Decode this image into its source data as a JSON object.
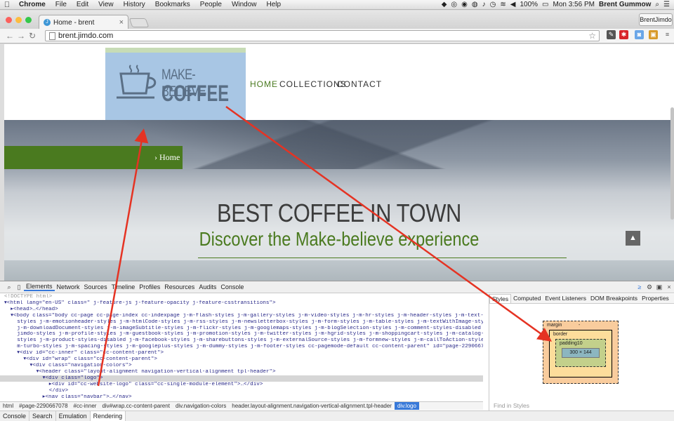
{
  "menubar": {
    "app": "Chrome",
    "items": [
      "File",
      "Edit",
      "View",
      "History",
      "Bookmarks",
      "People",
      "Window",
      "Help"
    ],
    "battery": "100%",
    "clock": "Mon 3:56 PM",
    "user": "Brent Gummow"
  },
  "browser": {
    "tab_title": "Home - brent",
    "url": "brent.jimdo.com",
    "profile": "BrentJimdo"
  },
  "page": {
    "logo_line1": "MAKE-BELIEVE",
    "logo_line2": "COFFEE",
    "nav": [
      "HOME",
      "COLLECTIONS",
      "CONTACT"
    ],
    "breadcrumb": "› Home",
    "headline": "BEST COFFEE IN TOWN",
    "subheadline": "Discover the Make-believe experience"
  },
  "devtools": {
    "tabs": [
      "Elements",
      "Network",
      "Sources",
      "Timeline",
      "Profiles",
      "Resources",
      "Audits",
      "Console"
    ],
    "dom_lines": [
      "<!DOCTYPE html>",
      "▾<html lang=\"en-US\" class=\" j-feature-js j-feature-opacity j-feature-csstransitions\">",
      "  ▸<head>…</head>",
      "  ▾<body class=\"body cc-page cc-page-index cc-indexpage j-m-flash-styles j-m-gallery-styles j-m-video-styles j-m-hr-styles j-m-header-styles j-m-text-",
      "    styles j-m-emotionheader-styles j-m-htmlCode-styles j-m-rss-styles j-m-newsletterbox-styles j-m-form-styles j-m-table-styles j-m-textWithImage-styles",
      "    j-m-downloadDocument-styles j-m-imageSubtitle-styles j-m-flickr-styles j-m-googlemaps-styles j-m-blogSelection-styles j-m-comment-styles-disabled j-m-",
      "    jimdo-styles j-m-profile-styles j-m-guestbook-styles j-m-promotion-styles j-m-twitter-styles j-m-hgrid-styles j-m-shoppingcart-styles j-m-catalog-",
      "    styles j-m-product-styles-disabled j-m-facebook-styles j-m-sharebuttons-styles j-m-externalSource-styles j-m-formnew-styles j-m-callToAction-styles j-",
      "    m-turbo-styles j-m-spacing-styles j-m-googleplus-styles j-m-dummy-styles j-m-footer-styles cc-pagemode-default cc-content-parent\" id=\"page-2290667078\">",
      "    ▾<div id=\"cc-inner\" class=\"cc-content-parent\">",
      "      ▾<div id=\"wrap\" class=\"cc-content-parent\">",
      "        ▾<div class=\"navigation-colors\">",
      "          ▾<header class=\"layout-alignment navigation-vertical-alignment tpl-header\">",
      "            ▾<div class=\"logo\">",
      "              ▸<div id=\"cc-website-logo\" class=\"cc-single-module-element\">…</div>",
      "              </div>",
      "            ▸<nav class=\"navbar\">…</nav>"
    ],
    "highlight_index": 13,
    "breadcrumb": [
      "html",
      "#page-2290667078",
      "#cc-inner",
      "div#wrap.cc-content-parent",
      "div.navigation-colors",
      "header.layout-alignment.navigation-vertical-alignment.tpl-header",
      "div.logo"
    ],
    "styles_tabs": [
      "Styles",
      "Computed",
      "Event Listeners",
      "DOM Breakpoints",
      "Properties"
    ],
    "box_model": {
      "margin_label": "margin",
      "border_label": "border",
      "padding_label": "padding10",
      "content": "300 × 144",
      "dash": "-"
    },
    "find_placeholder": "Find in Styles",
    "drawer_tabs": [
      "Console",
      "Search",
      "Emulation",
      "Rendering"
    ]
  },
  "colors": {
    "accent_green": "#4a7a1f",
    "annotation_red": "#e53323",
    "devtools_blue": "#3879d9"
  }
}
